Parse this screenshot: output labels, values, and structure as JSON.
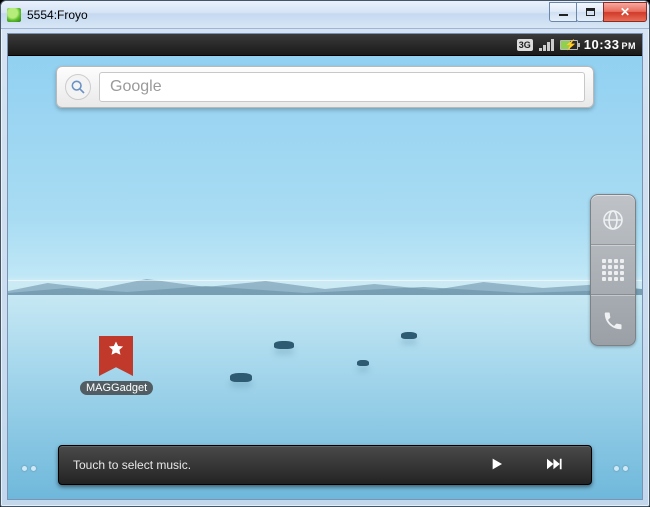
{
  "window": {
    "title": "5554:Froyo"
  },
  "statusbar": {
    "network_badge": "3G",
    "clock": "10:33",
    "ampm": "PM"
  },
  "search": {
    "placeholder": "Google"
  },
  "shortcut": {
    "label": "MAGGadget"
  },
  "music": {
    "prompt": "Touch to select music."
  }
}
